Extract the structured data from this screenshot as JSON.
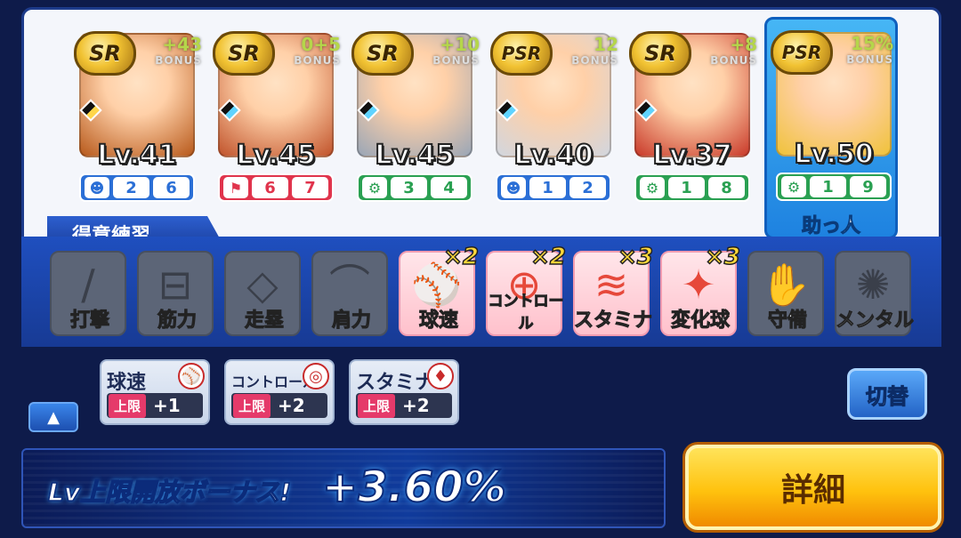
{
  "deck": {
    "cards": [
      {
        "rarity": "SR",
        "bonus": "+43",
        "bonus_label": "BONUS",
        "level": "Lv.41",
        "stat_type": "blue",
        "stat_icon": "☻",
        "stat_a": "2",
        "stat_b": "6",
        "portrait": "#b85a1c",
        "diamond": "yellow"
      },
      {
        "rarity": "SR",
        "bonus": "0+5",
        "bonus_label": "BONUS",
        "level": "Lv.45",
        "stat_type": "red",
        "stat_icon": "⚑",
        "stat_a": "6",
        "stat_b": "7",
        "portrait": "#c1542c",
        "diamond": "blue"
      },
      {
        "rarity": "SR",
        "bonus": "+10",
        "bonus_label": "BONUS",
        "level": "Lv.45",
        "stat_type": "green",
        "stat_icon": "⚙",
        "stat_a": "3",
        "stat_b": "4",
        "portrait": "#9aa6b6",
        "diamond": "blue"
      },
      {
        "rarity": "PSR",
        "bonus": "12",
        "bonus_label": "BONUS",
        "level": "Lv.40",
        "stat_type": "blue",
        "stat_icon": "☻",
        "stat_a": "1",
        "stat_b": "2",
        "portrait": "#d2d6de",
        "diamond": "blue"
      },
      {
        "rarity": "SR",
        "bonus": "+8",
        "bonus_label": "BONUS",
        "level": "Lv.37",
        "stat_type": "green",
        "stat_icon": "⚙",
        "stat_a": "1",
        "stat_b": "8",
        "portrait": "#c93a2a",
        "diamond": "blue"
      },
      {
        "rarity": "PSR",
        "bonus": "15%",
        "bonus_label": "BONUS",
        "level": "Lv.50",
        "stat_type": "green",
        "stat_icon": "⚙",
        "stat_a": "1",
        "stat_b": "9",
        "portrait": "#f0c23a",
        "diamond": "none"
      }
    ],
    "helper_label": "助っ人"
  },
  "specialty": {
    "tab_label": "得意練習",
    "practices": [
      {
        "label": "打撃",
        "active": false,
        "mult": "",
        "glyph": "/"
      },
      {
        "label": "筋力",
        "active": false,
        "mult": "",
        "glyph": "⊟"
      },
      {
        "label": "走塁",
        "active": false,
        "mult": "",
        "glyph": "◇"
      },
      {
        "label": "肩力",
        "active": false,
        "mult": "",
        "glyph": "⌒"
      },
      {
        "label": "球速",
        "active": true,
        "mult": "×2",
        "glyph": "⚾"
      },
      {
        "label": "コントロール",
        "active": true,
        "mult": "×2",
        "glyph": "⊕"
      },
      {
        "label": "スタミナ",
        "active": true,
        "mult": "×3",
        "glyph": "≋"
      },
      {
        "label": "変化球",
        "active": true,
        "mult": "×3",
        "glyph": "✦"
      },
      {
        "label": "守備",
        "active": false,
        "mult": "",
        "glyph": "✋"
      },
      {
        "label": "メンタル",
        "active": false,
        "mult": "",
        "glyph": "✺"
      }
    ]
  },
  "bonus_chips": [
    {
      "title": "球速",
      "cap": "上限",
      "plus": "+1",
      "icon": "⚾"
    },
    {
      "title": "コントロール",
      "cap": "上限",
      "plus": "+2",
      "icon": "◎"
    },
    {
      "title": "スタミナ",
      "cap": "上限",
      "plus": "+2",
      "icon": "♦"
    }
  ],
  "buttons": {
    "collapse": "▲",
    "switch": "切替",
    "detail": "詳細"
  },
  "level_cap_bonus": {
    "label": "Lv上限開放ボーナス!",
    "value": "+3.60%"
  }
}
